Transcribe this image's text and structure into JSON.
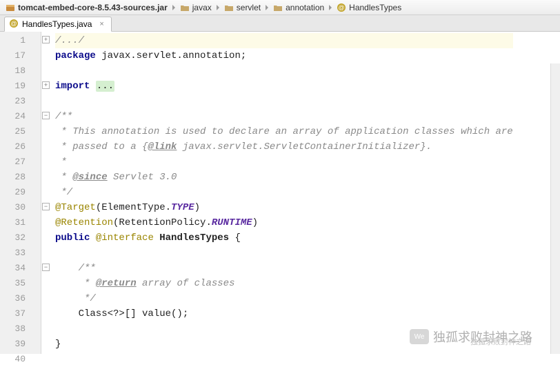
{
  "breadcrumb": [
    {
      "label": "tomcat-embed-core-8.5.43-sources.jar",
      "icon": "jar"
    },
    {
      "label": "javax",
      "icon": "folder"
    },
    {
      "label": "servlet",
      "icon": "folder"
    },
    {
      "label": "annotation",
      "icon": "folder"
    },
    {
      "label": "HandlesTypes",
      "icon": "annotation"
    }
  ],
  "tab": {
    "label": "HandlesTypes.java",
    "icon": "annotation"
  },
  "gutter_lines": [
    "1",
    "17",
    "18",
    "19",
    "23",
    "24",
    "25",
    "26",
    "27",
    "28",
    "29",
    "30",
    "31",
    "32",
    "33",
    "34",
    "35",
    "36",
    "37",
    "38",
    "39",
    "40"
  ],
  "code_lines": [
    {
      "html": "<span class='cmt'>/.../</span>",
      "hl": true,
      "fold": "+"
    },
    {
      "html": "<span class='kw'>package</span> javax.servlet.annotation;",
      "fold": ""
    },
    {
      "html": "",
      "fold": ""
    },
    {
      "html": "<span class='kw'>import</span> <span class='greenbox'>...</span>",
      "fold": "+"
    },
    {
      "html": "",
      "fold": ""
    },
    {
      "html": "<span class='cmt'>/**</span>",
      "fold": "-"
    },
    {
      "html": "<span class='cmt'> * This annotation is used to declare an array of application classes which are</span>",
      "fold": ""
    },
    {
      "html": "<span class='cmt'> * passed to a {</span><span class='cmt-em'>@link</span><span class='cmt'> javax.servlet.ServletContainerInitializer}.</span>",
      "fold": ""
    },
    {
      "html": "<span class='cmt'> *</span>",
      "fold": ""
    },
    {
      "html": "<span class='cmt'> * </span><span class='cmt-em'>@since</span><span class='cmt'> Servlet 3.0</span>",
      "fold": ""
    },
    {
      "html": "<span class='cmt'> */</span>",
      "fold": ""
    },
    {
      "html": "<span class='ann'>@Target</span>(ElementType.<span class='enumc'>TYPE</span>)",
      "fold": "-"
    },
    {
      "html": "<span class='ann'>@Retention</span>(RetentionPolicy.<span class='enumc'>RUNTIME</span>)",
      "fold": ""
    },
    {
      "html": "<span class='kw'>public</span> <span class='ann'>@interface</span> <span class='id'>HandlesTypes</span> {",
      "fold": ""
    },
    {
      "html": "",
      "fold": ""
    },
    {
      "html": "    <span class='cmt'>/**</span>",
      "fold": "-"
    },
    {
      "html": "    <span class='cmt'> * </span><span class='cmt-em'>@return</span><span class='cmt'> array of classes</span>",
      "fold": ""
    },
    {
      "html": "    <span class='cmt'> */</span>",
      "fold": ""
    },
    {
      "html": "    Class&lt;?&gt;[] value();",
      "fold": ""
    },
    {
      "html": "",
      "fold": ""
    },
    {
      "html": "}",
      "fold": ""
    },
    {
      "html": "",
      "fold": ""
    }
  ],
  "watermark": {
    "line1": "独孤求败封神之路",
    "line2": "独孤求败封神之路"
  }
}
